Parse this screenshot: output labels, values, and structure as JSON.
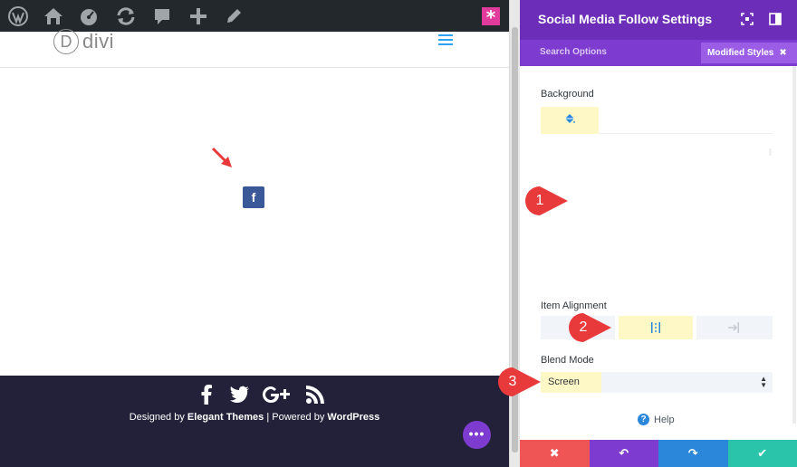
{
  "adminbar": {
    "icons": [
      "wordpress-icon",
      "home-icon",
      "dashboard-icon",
      "refresh-icon",
      "comment-icon",
      "plus-icon",
      "edit-icon"
    ],
    "divi_button_glyph": "*"
  },
  "site": {
    "logo_mark": "D",
    "logo_text": "divi",
    "menu_icon": "hamburger-icon",
    "module_icon": "f"
  },
  "footer": {
    "social_icons": [
      "facebook-icon",
      "twitter-icon",
      "google-plus-icon",
      "rss-icon"
    ],
    "credits_prefix": "Designed by ",
    "credits_theme": "Elegant Themes",
    "credits_separator": " | Powered by ",
    "credits_platform": "WordPress",
    "fab_label": "•••"
  },
  "panel": {
    "title": "Social Media Follow Settings",
    "tabs": {
      "search": "Search Options",
      "modified": "Modified Styles",
      "modified_close": "✖"
    },
    "background": {
      "label": "Background",
      "active_tab_icon": "paint-bucket-icon"
    },
    "item_alignment": {
      "label": "Item Alignment",
      "options": [
        "left",
        "center",
        "right"
      ],
      "selected": "center"
    },
    "blend_mode": {
      "label": "Blend Mode",
      "value": "Screen"
    },
    "help_label": "Help",
    "help_icon": "?",
    "footer": {
      "cancel": "✖",
      "undo": "↶",
      "redo": "↷",
      "save": "✔"
    }
  },
  "callouts": [
    "1",
    "2",
    "3"
  ],
  "colors": {
    "admin_bar": "#23282d",
    "panel_header": "#6c2eb9",
    "panel_tabs": "#7e3bd0",
    "modified_tab": "#9b5de5",
    "highlight": "#fdf8c5",
    "facebook": "#3b5998",
    "footer_bg": "#222139",
    "callout_red": "#e8393b",
    "cancel": "#ef5555",
    "undo": "#7e3bd0",
    "redo": "#2b87da",
    "save": "#29c4a9"
  }
}
